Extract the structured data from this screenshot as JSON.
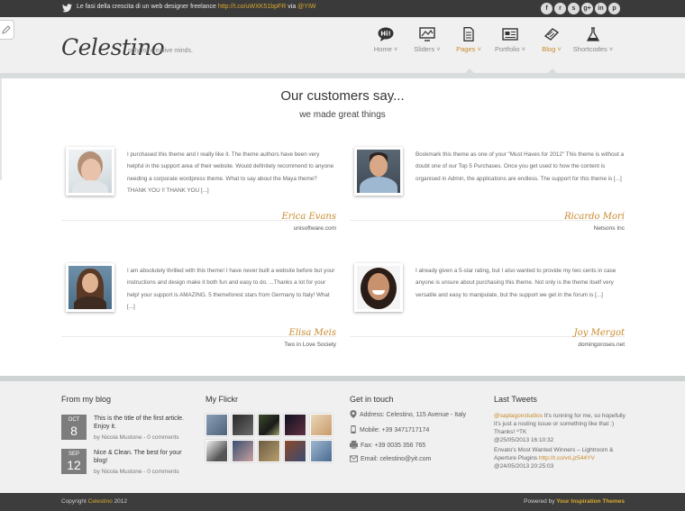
{
  "topbar": {
    "tweet_text": "Le fasi della crescita di un web designer freelance",
    "tweet_link": "http://t.co/uWXK51bpFR",
    "tweet_via": "via",
    "tweet_handle": "@YIW",
    "socials": [
      {
        "icon": "facebook-icon",
        "glyph": "f"
      },
      {
        "icon": "rss-icon",
        "glyph": "r"
      },
      {
        "icon": "skype-icon",
        "glyph": "s"
      },
      {
        "icon": "google-plus-icon",
        "glyph": "g+"
      },
      {
        "icon": "linkedin-icon",
        "glyph": "in"
      },
      {
        "icon": "pinterest-icon",
        "glyph": "p"
      }
    ]
  },
  "header": {
    "logo": "Celestino",
    "tagline": "only for creative minds.",
    "nav": [
      {
        "label": "Home ˅",
        "icon": "hi-bubble-icon"
      },
      {
        "label": "Sliders ˅",
        "icon": "slider-icon"
      },
      {
        "label": "Pages ˅",
        "icon": "page-icon"
      },
      {
        "label": "Portfolio ˅",
        "icon": "portfolio-icon"
      },
      {
        "label": "Blog ˅",
        "icon": "blog-icon"
      },
      {
        "label": "Shortcodes ˅",
        "icon": "flask-icon"
      }
    ]
  },
  "main": {
    "title": "Our customers say...",
    "subtitle": "we made great things",
    "testimonials": [
      {
        "quote": "I purchased this theme and I really like it. The theme authors have been very helpful in the support area of their website. Would definitely recommend to anyone needing a corporate wordpress theme. What to say about the Maya theme? THANK YOU !! THANK YOU [...]",
        "author": "Erica Evans",
        "company": "unisoftware.com"
      },
      {
        "quote": "Bookmark this theme as one of your \"Must Haves for 2012\" This theme is without a doubt one of our Top 5 Purchases. Once you get used to how the content is organised in Admin, the applications are endless. The support for this theme is [...]",
        "author": "Ricardo Mori",
        "company": "Netsons Inc"
      },
      {
        "quote": "I am absolutely thrilled with this theme! I have never built a website before but your instructions and design make it both fun and easy to do. ...Thanks a lot for your help! your support is AMAZING. 5 themeforest stars from Germany to Italy! What [...]",
        "author": "Elisa Meis",
        "company": "Two in Love Society"
      },
      {
        "quote": "I already given a 5-star rating, but I also wanted to provide my two cents in case anyone is unsure about purchasing this theme. Not only is the theme itself very versatile and easy to manipulate, but the support we get in the forum is [...]",
        "author": "Joy Mergot",
        "company": "domingoroses.net"
      }
    ]
  },
  "footer": {
    "blog": {
      "title": "From my blog",
      "posts": [
        {
          "month": "OCT",
          "day": "8",
          "title": "This is the title of the first article. Enjoy it.",
          "by": "by Nicola Mustone - 0 comments"
        },
        {
          "month": "SEP",
          "day": "12",
          "title": "Nice & Clean. The best for your blog!",
          "by": "by Nicola Mustone - 0 comments"
        }
      ]
    },
    "flickr": {
      "title": "My Flickr"
    },
    "contact": {
      "title": "Get in touch",
      "address": "Address: Celestino, 115 Avenue - Italy",
      "mobile": "Mobile: +39 3471717174",
      "fax": "Fax: +39 0035 356 765",
      "email": "Email: celestino@yit.com"
    },
    "tweets": {
      "title": "Last Tweets",
      "items": [
        {
          "handle": "@saptagonstudios",
          "text": " It's running for me, so hopefully it's just a routing issue or something like that :) Thanks! ^TK",
          "time": "@25/05/2013 16:10:32",
          "link": ""
        },
        {
          "handle": "",
          "text": "Envato's Most Wanted Winners – Lightroom & Aperture Plugins ",
          "time": "@24/05/2013 20:25:03",
          "link": "http://t.co/vrLjz544YV"
        }
      ]
    }
  },
  "bottom": {
    "copyright_prefix": "Copyright",
    "copyright_brand": "Celestino",
    "copyright_year": "2012",
    "powered_prefix": "Powered by",
    "powered_brand": "Your Inspiration Themes"
  }
}
